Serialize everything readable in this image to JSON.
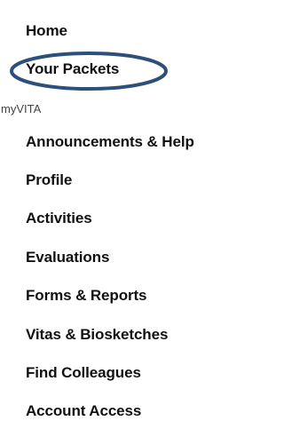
{
  "nav": {
    "top_items": [
      {
        "label": "Home"
      },
      {
        "label": "Your Packets"
      }
    ],
    "section_label": "myVITA",
    "section_items": [
      {
        "label": "Announcements & Help"
      },
      {
        "label": "Profile"
      },
      {
        "label": "Activities"
      },
      {
        "label": "Evaluations"
      },
      {
        "label": "Forms & Reports"
      },
      {
        "label": "Vitas & Biosketches"
      },
      {
        "label": "Find Colleagues"
      },
      {
        "label": "Account Access"
      }
    ]
  },
  "highlight": {
    "target": "Your Packets",
    "color": "#2d4f7c"
  }
}
